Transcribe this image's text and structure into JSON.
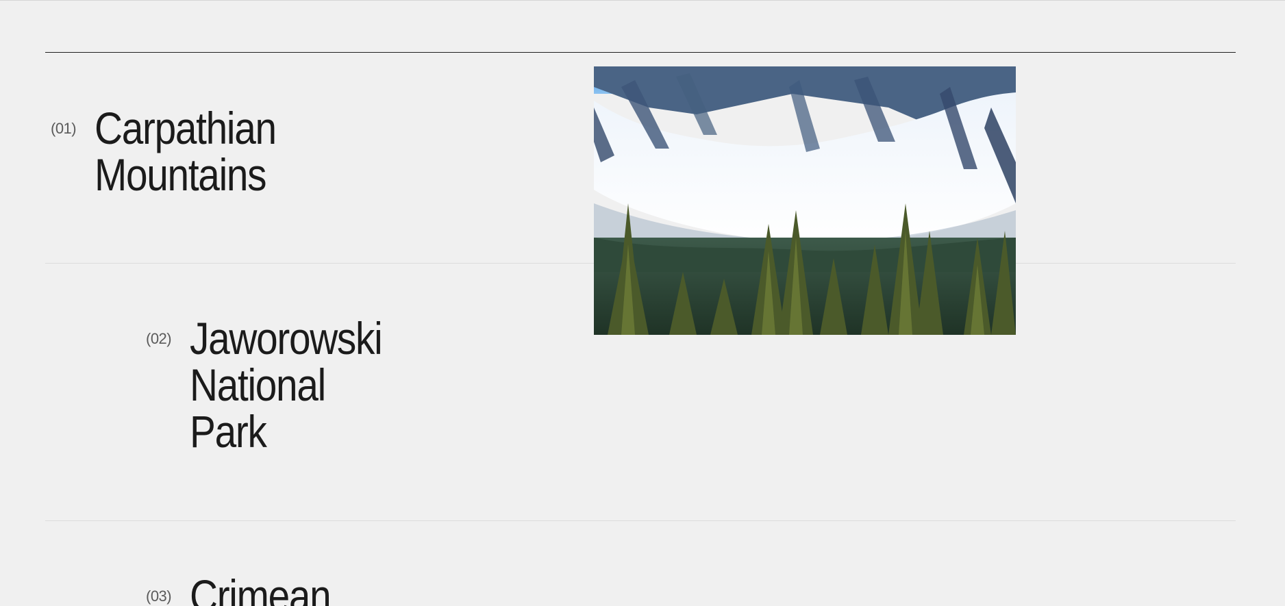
{
  "list": {
    "items": [
      {
        "index": "(01)",
        "title": "Carpathian\nMountains"
      },
      {
        "index": "(02)",
        "title": "Jaworowski\nNational\nPark"
      },
      {
        "index": "(03)",
        "title": "Crimean"
      }
    ]
  },
  "preview": {
    "alt": "Snowy mountain valley with evergreen forest"
  },
  "colors": {
    "background": "#f0f0f0",
    "text": "#1b1b1b",
    "rule": "#1f1f1f",
    "divider": "#dcdcdc"
  }
}
